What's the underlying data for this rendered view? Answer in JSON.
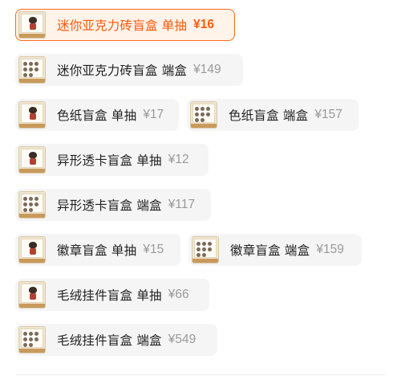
{
  "options": [
    {
      "label": "迷你亚克力砖盲盒 单抽",
      "price": "¥16",
      "thumb": "figure-icon"
    },
    {
      "label": "迷你亚克力砖盲盒 端盒",
      "price": "¥149",
      "thumb": "grid-icon"
    },
    {
      "label": "色纸盲盒 单抽",
      "price": "¥17",
      "thumb": "figure-icon"
    },
    {
      "label": "色纸盲盒 端盒",
      "price": "¥157",
      "thumb": "grid-icon"
    },
    {
      "label": "异形透卡盲盒 单抽",
      "price": "¥12",
      "thumb": "figure-icon"
    },
    {
      "label": "异形透卡盲盒 端盒",
      "price": "¥117",
      "thumb": "grid-icon"
    },
    {
      "label": "徽章盲盒 单抽",
      "price": "¥15",
      "thumb": "figure-icon"
    },
    {
      "label": "徽章盲盒 端盒",
      "price": "¥159",
      "thumb": "grid-icon"
    },
    {
      "label": "毛绒挂件盲盒 单抽",
      "price": "¥66",
      "thumb": "figure-icon"
    },
    {
      "label": "毛绒挂件盲盒 端盒",
      "price": "¥549",
      "thumb": "grid-icon"
    }
  ],
  "selected_option": "迷你亚克力砖盲盒 单抽",
  "colors": {
    "accent": "#ff5a0a",
    "selected_bg": "#fff3ea",
    "chip_bg": "#f5f5f5",
    "price_gray": "#999999"
  }
}
